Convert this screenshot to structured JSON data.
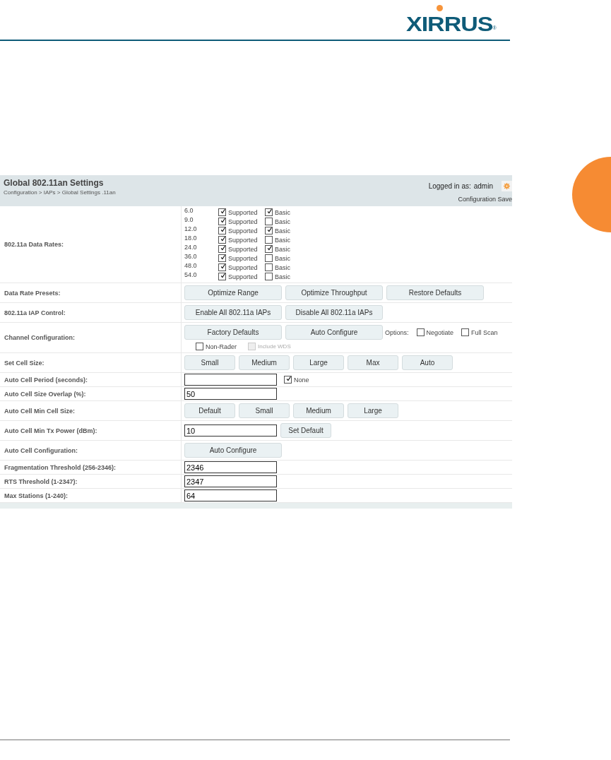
{
  "logo": {
    "text": "XIRRUS",
    "mark": "®"
  },
  "panel": {
    "title": "Global 802.11an Settings",
    "breadcrumb": "Configuration > IAPs > Global Settings .11an",
    "user_label": "Logged in as:",
    "user": "admin",
    "status": "Configuration Save"
  },
  "rows": [
    {
      "kind": "rates",
      "label": "802.11a Data Rates:",
      "rates": [
        {
          "rate": "6.0",
          "supported_label": "Supported",
          "supported": true,
          "basic_label": "Basic",
          "basic": true
        },
        {
          "rate": "9.0",
          "supported_label": "Supported",
          "supported": true,
          "basic_label": "Basic",
          "basic": false
        },
        {
          "rate": "12.0",
          "supported_label": "Supported",
          "supported": true,
          "basic_label": "Basic",
          "basic": true
        },
        {
          "rate": "18.0",
          "supported_label": "Supported",
          "supported": true,
          "basic_label": "Basic",
          "basic": false
        },
        {
          "rate": "24.0",
          "supported_label": "Supported",
          "supported": true,
          "basic_label": "Basic",
          "basic": true
        },
        {
          "rate": "36.0",
          "supported_label": "Supported",
          "supported": true,
          "basic_label": "Basic",
          "basic": false
        },
        {
          "rate": "48.0",
          "supported_label": "Supported",
          "supported": true,
          "basic_label": "Basic",
          "basic": false
        },
        {
          "rate": "54.0",
          "supported_label": "Supported",
          "supported": true,
          "basic_label": "Basic",
          "basic": false
        }
      ]
    },
    {
      "kind": "buttons",
      "label": "Data Rate Presets:",
      "buttons": [
        "Optimize Range",
        "Optimize Throughput",
        "Restore Defaults"
      ]
    },
    {
      "kind": "buttons",
      "label": "802.11a IAP Control:",
      "buttons": [
        "Enable All 802.11a IAPs",
        "Disable All 802.11a IAPs"
      ]
    },
    {
      "kind": "channel",
      "label": "Channel Configuration:",
      "buttons": [
        "Factory Defaults",
        "Auto Configure"
      ],
      "options_label": "Options:",
      "options": [
        {
          "label": "Negotiate",
          "checked": false,
          "disabled": false
        },
        {
          "label": "Full Scan",
          "checked": false,
          "disabled": false
        }
      ],
      "extra_options": [
        {
          "label": "Non-Rader",
          "checked": false,
          "disabled": false
        },
        {
          "label": "Include WDS",
          "checked": false,
          "disabled": true
        }
      ]
    },
    {
      "kind": "small_buttons",
      "label": "Set Cell Size:",
      "buttons": [
        "Small",
        "Medium",
        "Large",
        "Max",
        "Auto"
      ]
    },
    {
      "kind": "input_check",
      "label": "Auto Cell Period (seconds):",
      "value": "",
      "check": {
        "label": "None",
        "checked": true,
        "disabled": false
      }
    },
    {
      "kind": "input",
      "label": "Auto Cell Size Overlap (%):",
      "value": "50"
    },
    {
      "kind": "small_buttons",
      "label": "Auto Cell Min Cell Size:",
      "buttons": [
        "Default",
        "Small",
        "Medium",
        "Large"
      ]
    },
    {
      "kind": "input_button",
      "label": "Auto Cell Min Tx Power (dBm):",
      "value": "10",
      "button": "Set Default"
    },
    {
      "kind": "buttons",
      "label": "Auto Cell Configuration:",
      "buttons": [
        "Auto Configure"
      ]
    },
    {
      "kind": "input",
      "label": "Fragmentation Threshold (256-2346):",
      "value": "2346"
    },
    {
      "kind": "input",
      "label": "RTS Threshold (1-2347):",
      "value": "2347"
    },
    {
      "kind": "input",
      "label": "Max Stations (1-240):",
      "value": "64"
    }
  ]
}
